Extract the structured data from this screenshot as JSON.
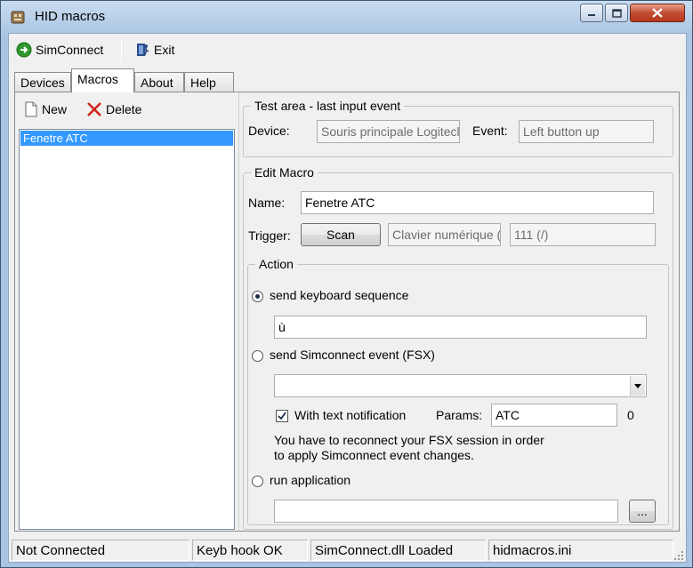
{
  "window": {
    "title": "HID macros"
  },
  "toolbar": {
    "simconnect_label": "SimConnect",
    "exit_label": "Exit"
  },
  "tabs": [
    "Devices",
    "Macros",
    "About",
    "Help"
  ],
  "macros": {
    "new_label": "New",
    "delete_label": "Delete",
    "items": [
      "Fenetre ATC"
    ]
  },
  "test_area": {
    "title": "Test area - last input event",
    "device_label": "Device:",
    "device_value": "Souris principale Logitecl",
    "event_label": "Event:",
    "event_value": "Left button up"
  },
  "edit_macro": {
    "title": "Edit Macro",
    "name_label": "Name:",
    "name_value": "Fenetre ATC",
    "trigger_label": "Trigger:",
    "scan_label": "Scan",
    "trigger_device": "Clavier numérique (",
    "trigger_key": "111  (/)"
  },
  "action": {
    "title": "Action",
    "send_keyboard_label": "send keyboard sequence",
    "keyboard_sequence": "ù",
    "send_simconnect_label": "send Simconnect event (FSX)",
    "simconnect_event": "",
    "text_notification_label": "With text notification",
    "text_notification_checked": true,
    "params_label": "Params:",
    "params_value": "ATC",
    "params_count": "0",
    "reconnect_note_1": "You have to reconnect your FSX session in order",
    "reconnect_note_2": "to apply Simconnect event changes.",
    "run_application_label": "run application",
    "application_path": "",
    "browse_label": "..."
  },
  "status": {
    "connection": "Not Connected",
    "hook": "Keyb hook OK",
    "dll": "SimConnect.dll Loaded",
    "ini": "hidmacros.ini"
  }
}
